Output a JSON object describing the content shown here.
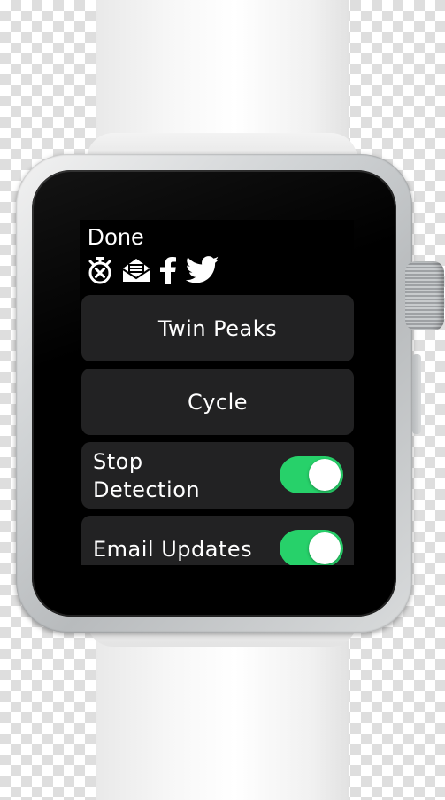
{
  "header": {
    "done_label": "Done"
  },
  "icons": [
    "stopwatch-cancel-icon",
    "mail-icon",
    "facebook-icon",
    "twitter-icon"
  ],
  "menu": {
    "twin_peaks_label": "Twin Peaks",
    "cycle_label": "Cycle"
  },
  "toggles": [
    {
      "label": "Stop\nDetection",
      "on": true
    },
    {
      "label": "Email Updates",
      "on": true
    }
  ],
  "colors": {
    "screen_bg": "#000000",
    "card_bg": "#222223",
    "switch_on": "#27d16a",
    "text": "#ffffff"
  }
}
